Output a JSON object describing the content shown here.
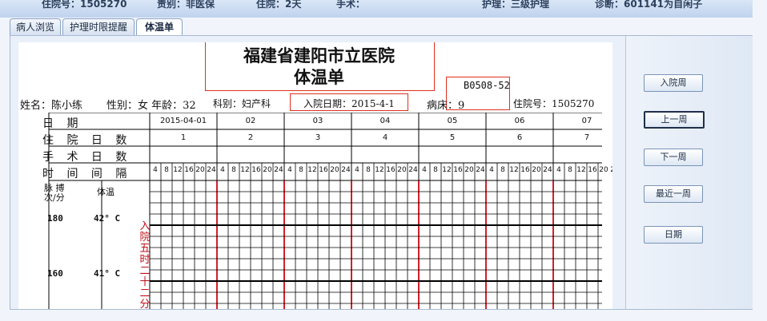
{
  "header_bar": {
    "items": [
      "住院号：1505270",
      "责别：非医保",
      "住院：2天",
      "手术：",
      "护理：三级护理",
      "诊断：601141为自闲子"
    ]
  },
  "tabs": [
    {
      "label": "病人浏览",
      "active": false
    },
    {
      "label": "护理时限提醒",
      "active": false
    },
    {
      "label": "体温单",
      "active": true
    }
  ],
  "form": {
    "hospital": "福建省建阳市立医院",
    "form_title": "体温单",
    "bed_code": "B0508-52",
    "patient": {
      "name": "姓名：陈小练",
      "gender_age": "性别：女 年龄：32",
      "dept": "科别：妇产科",
      "admit_date": "入院日期：2015-4-1",
      "bed": "病床：9",
      "inpatient_no": "住院号：1505270"
    }
  },
  "table": {
    "row_labels": {
      "date": "日 期",
      "days": "住 院 日 数",
      "surgery": "手 术 日 数",
      "interval": "时 间 间 隔"
    },
    "dates": [
      "2015-04-01",
      "02",
      "03",
      "04",
      "05",
      "06",
      "07"
    ],
    "day_numbers": [
      "1",
      "2",
      "3",
      "4",
      "5",
      "6",
      "7"
    ],
    "hours": [
      "4",
      "8",
      "12",
      "16",
      "20",
      "24"
    ],
    "pulse_label": "脉 搏\n次/分",
    "temp_label": "体温",
    "pulse_scale": [
      "180",
      "160"
    ],
    "temp_scale": [
      "42° C",
      "41° C"
    ],
    "admission_note": "入院五时二十二分"
  },
  "buttons": {
    "admit_week": "入院周",
    "prev_week": "上一周",
    "next_week": "下一周",
    "recent_week": "最近一周",
    "date": "日期"
  },
  "colors": {
    "accent_red": "#e0301e",
    "day_line_red": "#d0202a"
  }
}
